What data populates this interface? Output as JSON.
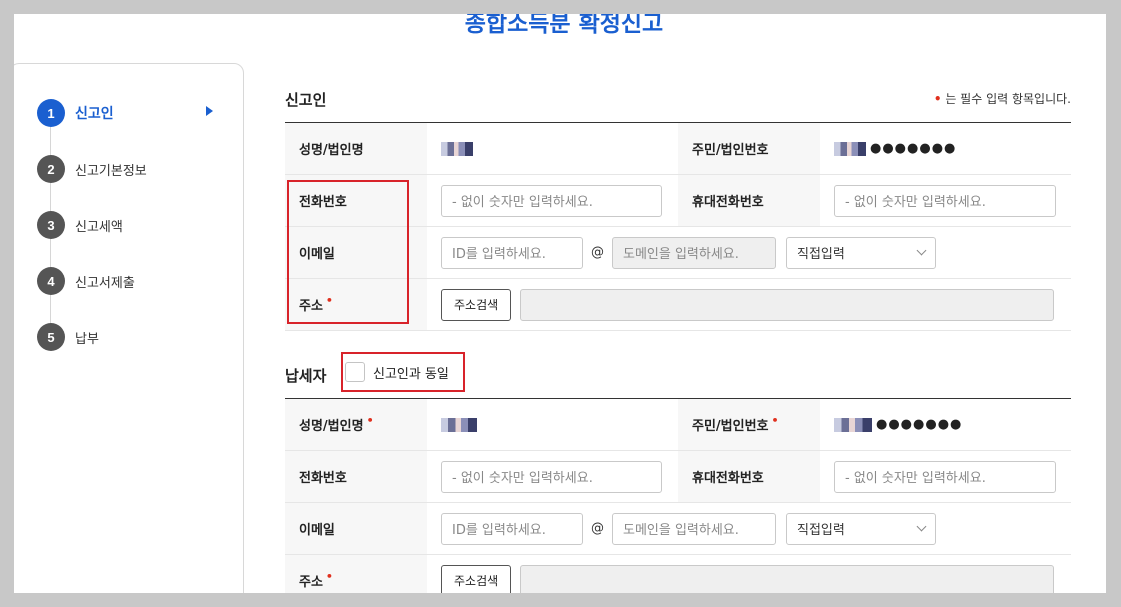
{
  "page_title": "종합소득분 확정신고",
  "steps": [
    {
      "num": "1",
      "label": "신고인",
      "active": true
    },
    {
      "num": "2",
      "label": "신고기본정보"
    },
    {
      "num": "3",
      "label": "신고세액"
    },
    {
      "num": "4",
      "label": "신고서제출"
    },
    {
      "num": "5",
      "label": "납부"
    }
  ],
  "required_note": {
    "dot": "•",
    "text": " 는 필수 입력 항목입니다."
  },
  "reporter": {
    "title": "신고인",
    "name_label": "성명/법인명",
    "name_value": "",
    "id_label": "주민/법인번호",
    "id_value": "●●●●●●●",
    "phone_label": "전화번호",
    "phone_placeholder": "- 없이 숫자만 입력하세요.",
    "mobile_label": "휴대전화번호",
    "mobile_placeholder": "- 없이 숫자만 입력하세요.",
    "email_label": "이메일",
    "email_id_placeholder": "ID를 입력하세요.",
    "at": "@",
    "email_domain_placeholder": "도메인을 입력하세요.",
    "domain_select": "직접입력",
    "address_label": "주소",
    "address_button": "주소검색"
  },
  "taxpayer": {
    "title": "납세자",
    "same_label": "신고인과 동일",
    "name_label": "성명/법인명",
    "id_label": "주민/법인번호",
    "id_value": "●●●●●●●",
    "phone_label": "전화번호",
    "phone_placeholder": "- 없이 숫자만 입력하세요.",
    "mobile_label": "휴대전화번호",
    "mobile_placeholder": "- 없이 숫자만 입력하세요.",
    "email_label": "이메일",
    "email_id_placeholder": "ID를 입력하세요.",
    "at": "@",
    "email_domain_placeholder": "도메인을 입력하세요.",
    "domain_select": "직접입력",
    "address_label": "주소",
    "address_button": "주소검색"
  },
  "colors": {
    "accent": "#1a5fd0",
    "required": "#e0301e",
    "highlight": "#d8232a"
  }
}
